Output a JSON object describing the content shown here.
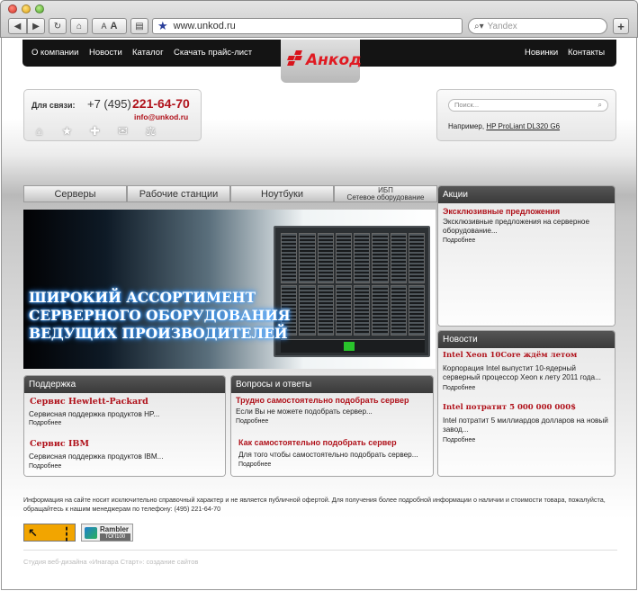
{
  "browser": {
    "url": "www.unkod.ru",
    "search_placeholder": "Yandex",
    "font_small": "A",
    "font_large": "A",
    "add_tab": "+"
  },
  "nav": {
    "left": [
      "О компании",
      "Новости",
      "Каталог",
      "Скачать прайс-лист"
    ],
    "right": [
      "Новинки",
      "Контакты"
    ]
  },
  "logo": {
    "text": "Анкод"
  },
  "contact": {
    "label": "Для связи:",
    "prefix": "+7 (495)",
    "phone": "221-64-70",
    "email": "info@unkod.ru",
    "icons": [
      "home-icon",
      "star-icon",
      "plus-icon",
      "mail-icon",
      "scales-icon"
    ]
  },
  "site_search": {
    "placeholder": "Поиск...",
    "example_label": "Например,",
    "example_link": "HP ProLiant DL320 G6"
  },
  "categories": [
    {
      "label": "Серверы"
    },
    {
      "label": "Рабочие станции"
    },
    {
      "label": "Ноутбуки"
    },
    {
      "label_top": "ИБП",
      "label_bottom": "Сетевое оборудование"
    }
  ],
  "banner": {
    "lines": [
      "ШИРОКИЙ АССОРТИМЕНТ",
      "СЕРВЕРНОГО ОБОРУДОВАНИЯ",
      "ВЕДУЩИХ ПРОИЗВОДИТЕЛЕЙ"
    ]
  },
  "promos": {
    "title": "Акции",
    "item_title": "Эксклюзивные предложения",
    "item_text": "Эксклюзивные предложения на серверное оборудование...",
    "more": "Подробнее"
  },
  "news": {
    "title": "Новости",
    "items": [
      {
        "title": "Intel Xeon 10Core ждём летом",
        "text": "Корпорация Intel выпустит 10-ядерный серверный процессор Xeon к лету 2011 года...",
        "more": "Подробнее"
      },
      {
        "title": "Intel потратит 5 000 000 000$",
        "text": "Intel потратит 5 миллиардов долларов на новый завод...",
        "more": "Подробнее"
      }
    ]
  },
  "support": {
    "title": "Поддержка",
    "items": [
      {
        "title": "Сервис Hewlett-Packard",
        "text": "Сервисная поддержка продуктов HP...",
        "more": "Подробнее"
      },
      {
        "title": "Сервис IBM",
        "text": "Сервисная поддержка продуктов IBM...",
        "more": "Подробнее"
      }
    ]
  },
  "qa": {
    "title": "Вопросы и ответы",
    "items": [
      {
        "title": "Трудно самостоятельно подобрать сервер",
        "text": "Если Вы не можете подобрать сервер...",
        "more": "Подробнее"
      },
      {
        "title": "Как самостоятельно подобрать сервер",
        "text": "Для того чтобы самостоятельно подобрать сервер...",
        "more": "Подробнее"
      }
    ]
  },
  "footer": {
    "note": "Информация на сайте носит исключительно справочный характер и не является публичной офертой. Для получения более подробной информации о наличии и стоимости товара, пожалуйста, обращайтесь к нашим менеджерам по телефону: (495) 221-64-70",
    "rambler_top": "Rambler",
    "rambler_bottom": "ТОП100",
    "credit": "Студия веб-дизайна «Инагара Старт»: создание сайтов"
  },
  "colors": {
    "accent_red": "#b0121b",
    "nav_bg": "#141414"
  }
}
